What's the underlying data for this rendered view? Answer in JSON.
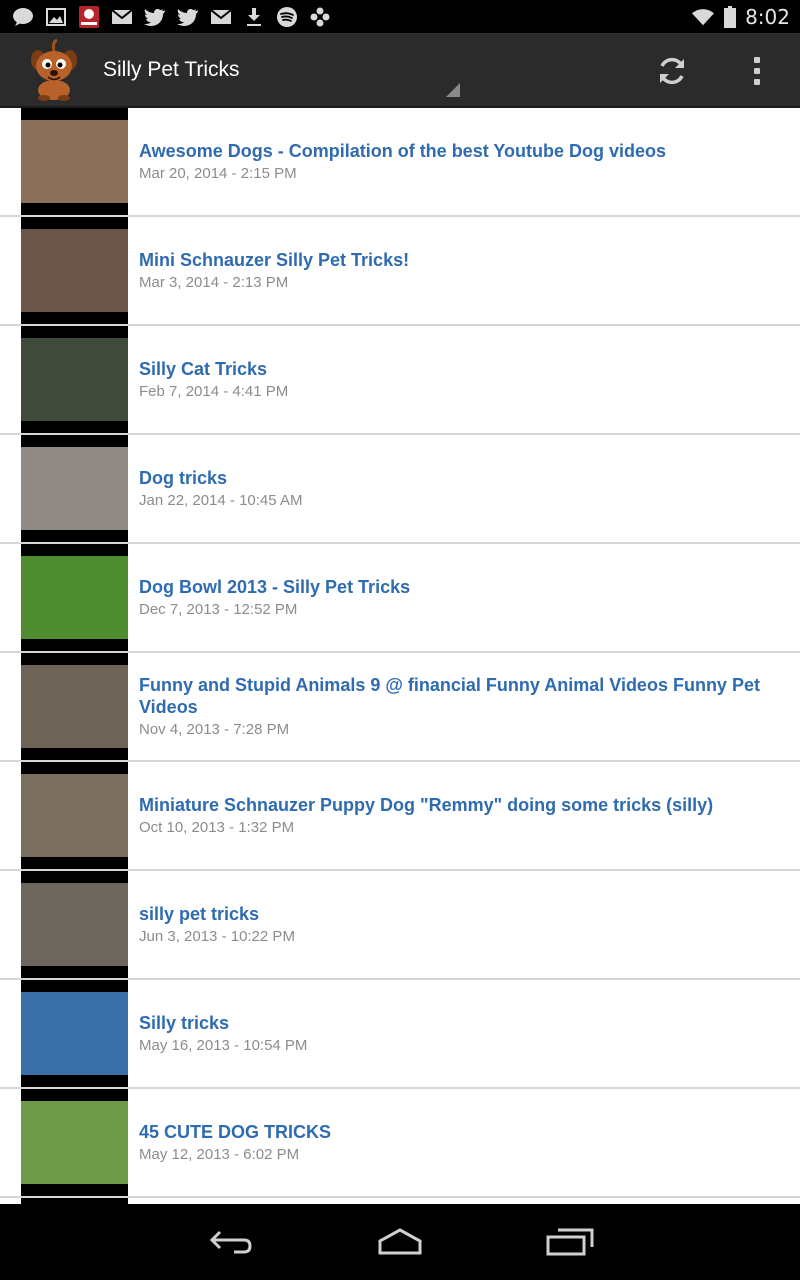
{
  "status_bar": {
    "time": "8:02",
    "icons": [
      "chat-bubble-icon",
      "image-icon",
      "world-app-icon",
      "gmail-icon",
      "twitter-icon",
      "twitter-icon",
      "gmail-icon",
      "download-icon",
      "spotify-icon",
      "game-controller-icon",
      "wifi-icon",
      "battery-icon"
    ]
  },
  "action_bar": {
    "title": "Silly Pet Tricks",
    "logo_icon": "cartoon-dog-icon",
    "refresh_icon": "refresh-icon",
    "overflow_icon": "overflow-menu-icon"
  },
  "videos": [
    {
      "title": "Awesome Dogs - Compilation of the best Youtube Dog videos",
      "date": "Mar 20, 2014 - 2:15 PM",
      "thumb_color": "#8a6f5a"
    },
    {
      "title": "Mini Schnauzer Silly Pet Tricks!",
      "date": "Mar 3, 2014 - 2:13 PM",
      "thumb_color": "#6b5449"
    },
    {
      "title": "Silly Cat Tricks",
      "date": "Feb 7, 2014 - 4:41 PM",
      "thumb_color": "#3f4a3a"
    },
    {
      "title": "Dog tricks",
      "date": "Jan 22, 2014 - 10:45 AM",
      "thumb_color": "#8f8a83"
    },
    {
      "title": "Dog Bowl 2013 - Silly Pet Tricks",
      "date": "Dec 7, 2013 - 12:52 PM",
      "thumb_color": "#4f8b2f"
    },
    {
      "title": "Funny and Stupid Animals 9 @ financial Funny Animal Videos Funny Pet Videos",
      "date": "Nov 4, 2013 - 7:28 PM",
      "thumb_color": "#6d6356"
    },
    {
      "title": "Miniature Schnauzer Puppy Dog \"Remmy\" doing some tricks (silly)",
      "date": "Oct 10, 2013 - 1:32 PM",
      "thumb_color": "#7b6f60"
    },
    {
      "title": "silly pet tricks",
      "date": "Jun 3, 2013 - 10:22 PM",
      "thumb_color": "#6e675f"
    },
    {
      "title": "Silly tricks",
      "date": "May 16, 2013 - 10:54 PM",
      "thumb_color": "#3a6fa8"
    },
    {
      "title": "45 CUTE DOG TRICKS",
      "date": "May 12, 2013 - 6:02 PM",
      "thumb_color": "#6f9a4a"
    }
  ],
  "nav_bar": {
    "back_icon": "back-icon",
    "home_icon": "home-icon",
    "recents_icon": "recent-apps-icon"
  }
}
